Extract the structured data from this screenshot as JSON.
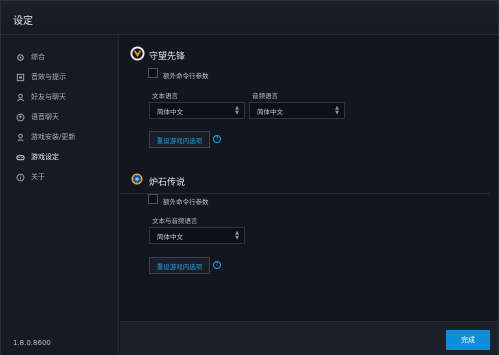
{
  "window": {
    "title": "设定"
  },
  "sidebar": {
    "items": [
      {
        "label": "综合",
        "icon": "gear-icon"
      },
      {
        "label": "音效与提示",
        "icon": "sound-icon"
      },
      {
        "label": "好友与聊天",
        "icon": "friends-icon"
      },
      {
        "label": "语音聊天",
        "icon": "microphone-icon"
      },
      {
        "label": "游戏安装/更新",
        "icon": "download-icon"
      },
      {
        "label": "游戏设定",
        "icon": "gamepad-icon",
        "active": true
      },
      {
        "label": "关于",
        "icon": "info-icon"
      }
    ],
    "version": "1.8.0.8600"
  },
  "overwatch": {
    "title": "守望先锋",
    "extra_args_label": "额外命令行参数",
    "text_lang_label": "文本语言",
    "text_lang_value": "简体中文",
    "audio_lang_label": "音频语言",
    "audio_lang_value": "简体中文",
    "reset_label": "重设游戏内选项"
  },
  "hearthstone": {
    "title": "炉石传说",
    "extra_args_label": "额外命令行参数",
    "lang_label": "文本与音频语言",
    "lang_value": "简体中文",
    "reset_label": "重设游戏内选项"
  },
  "footer": {
    "done_label": "完成"
  },
  "colors": {
    "accent": "#0f8ed8",
    "link": "#1fa0e6"
  }
}
